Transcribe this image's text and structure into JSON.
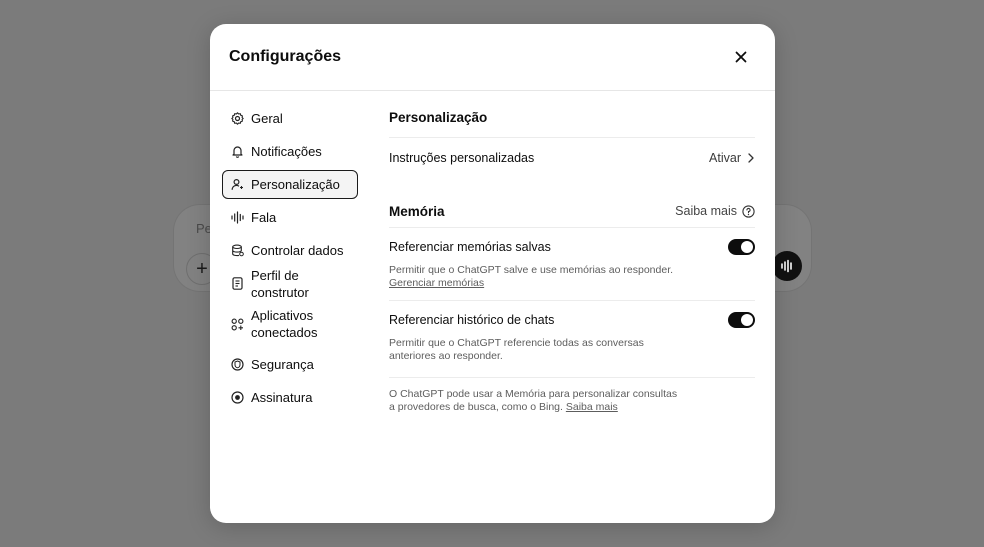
{
  "composer": {
    "placeholder": "Pe",
    "plus_symbol": "+"
  },
  "modal": {
    "title": "Configurações"
  },
  "sidebar": {
    "items": [
      {
        "label": "Geral",
        "icon": "gear-icon"
      },
      {
        "label": "Notificações",
        "icon": "bell-icon"
      },
      {
        "label": "Personalização",
        "icon": "person-icon",
        "active": true
      },
      {
        "label": "Fala",
        "icon": "waveform-icon"
      },
      {
        "label": "Controlar dados",
        "icon": "database-icon"
      },
      {
        "label": "Perfil de construtor",
        "icon": "id-card-icon"
      },
      {
        "label": "Aplicativos conectados",
        "icon": "apps-icon"
      },
      {
        "label": "Segurança",
        "icon": "shield-icon"
      },
      {
        "label": "Assinatura",
        "icon": "subscription-icon"
      }
    ]
  },
  "personalization": {
    "title": "Personalização",
    "custom_instructions_label": "Instruções personalizadas",
    "custom_instructions_action": "Ativar"
  },
  "memory": {
    "title": "Memória",
    "learn_more": "Saiba mais",
    "settings": [
      {
        "label": "Referenciar memórias salvas",
        "description": "Permitir que o ChatGPT salve e use memórias ao responder.",
        "link": "Gerenciar memórias",
        "enabled": true
      },
      {
        "label": "Referenciar histórico de chats",
        "description": "Permitir que o ChatGPT referencie todas as conversas anteriores ao responder.",
        "enabled": true
      }
    ],
    "footer_text": "O ChatGPT pode usar a Memória para personalizar consultas a provedores de busca, como o Bing.",
    "footer_link": "Saiba mais"
  }
}
